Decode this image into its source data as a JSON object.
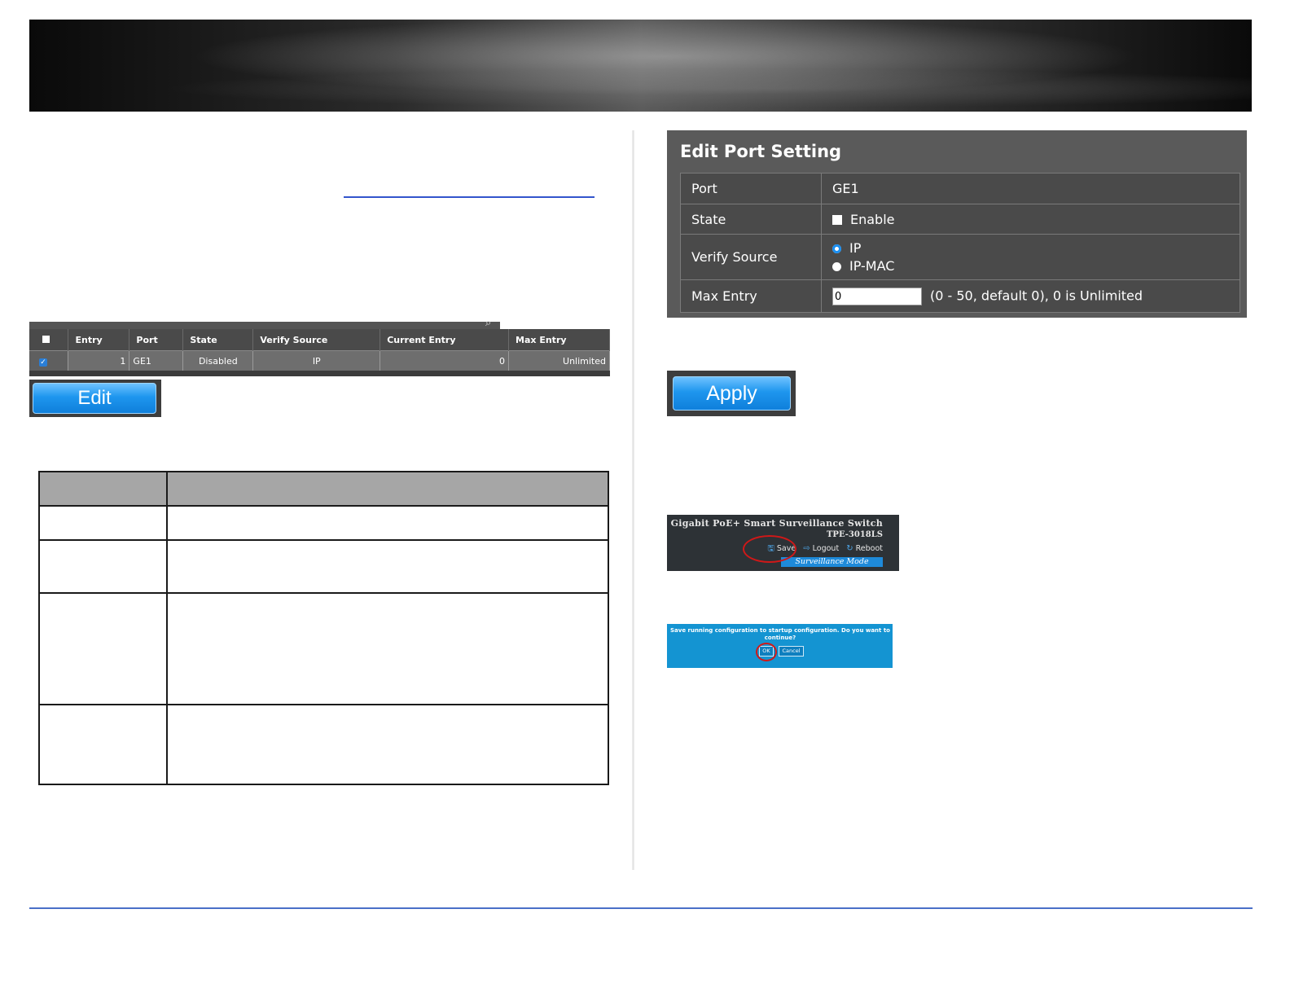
{
  "binding_table": {
    "headers": [
      "Entry",
      "Port",
      "State",
      "Verify Source",
      "Current Entry",
      "Max Entry"
    ],
    "row": {
      "checked": true,
      "entry": "1",
      "port": "GE1",
      "state": "Disabled",
      "verify_source": "IP",
      "current_entry": "0",
      "max_entry": "Unlimited"
    }
  },
  "edit_button_label": "Edit",
  "apply_button_label": "Apply",
  "edit_port_setting": {
    "title": "Edit Port Setting",
    "port_label": "Port",
    "port_value": "GE1",
    "state_label": "State",
    "state_option": "Enable",
    "verify_label": "Verify Source",
    "verify_options": [
      "IP",
      "IP-MAC"
    ],
    "verify_selected": "IP",
    "max_label": "Max Entry",
    "max_value": "0",
    "max_hint": "(0 - 50, default 0), 0 is Unlimited"
  },
  "header_thumb": {
    "product": "Gigabit PoE+ Smart Surveillance Switch",
    "model": "TPE-3018LS",
    "save": "Save",
    "logout": "Logout",
    "reboot": "Reboot",
    "mode": "Surveillance Mode"
  },
  "confirm_thumb": {
    "message": "Save running configuration to startup configuration. Do you want to continue?",
    "ok": "OK",
    "cancel": "Cancel"
  },
  "colors": {
    "accent_blue": "#1e96ee",
    "highlight_red": "#d01818",
    "panel_gray": "#5a5a5a"
  }
}
